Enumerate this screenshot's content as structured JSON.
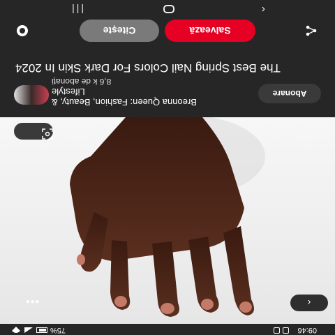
{
  "status_bar": {
    "time": "09:46",
    "battery": "75%"
  },
  "pin": {
    "title": "The Best Spring Nail Colors For Dark Skin In 2024",
    "back_icon": "chevron-left-icon",
    "more_icon": "more-dots-icon",
    "visual_search_icon": "lens-icon"
  },
  "creator": {
    "name": "Breonna Queen: Fashion, Beauty, & Lifestyle",
    "followers": "8,6 k de abonați",
    "subscribe_label": "Abonare"
  },
  "actions": {
    "read_label": "Citește",
    "save_label": "Salvează",
    "share_icon": "share-icon",
    "comment_icon": "comment-icon"
  },
  "nav": {
    "back_icon": "nav-back-icon",
    "home_icon": "nav-home-icon",
    "recent_icon": "nav-recent-icon"
  },
  "colors": {
    "save": "#e60023",
    "read": "#7a7a7a",
    "background": "#262626"
  }
}
